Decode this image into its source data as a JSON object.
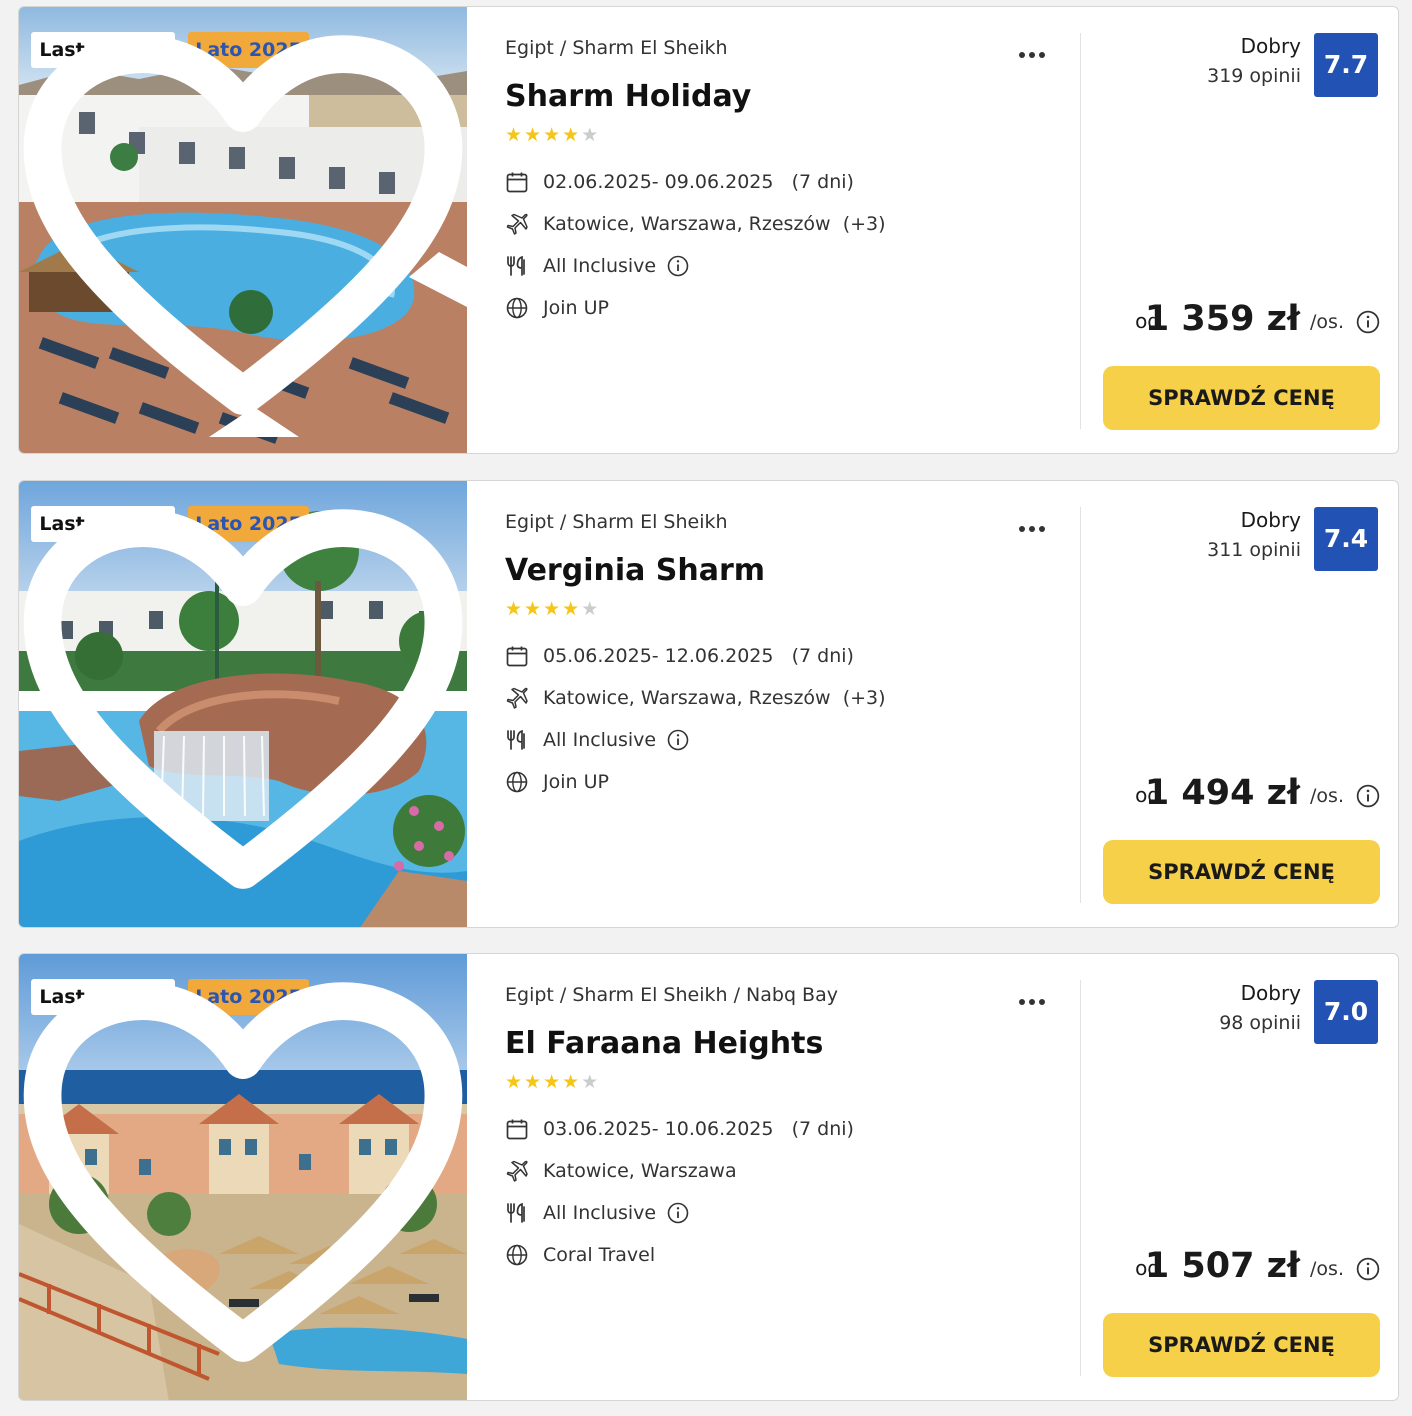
{
  "colors": {
    "badge_season_bg": "#f2a93b",
    "badge_season_text": "#2a55b3",
    "score_bg": "#2352b5",
    "cta_bg": "#f6d048",
    "star_filled": "#f5c518",
    "star_empty": "#cccccc"
  },
  "offers": [
    {
      "badge_last_minute": "Last minute",
      "badge_season": "Lato 2025",
      "location": "Egipt / Sharm El Sheikh",
      "name": "Sharm Holiday",
      "stars": 4,
      "max_stars": 5,
      "dates": "02.06.2025- 09.06.2025",
      "duration": "(7 dni)",
      "departures": "Katowice, Warszawa, Rzeszów",
      "departures_more": "(+3)",
      "board": "All Inclusive",
      "operator": "Join UP",
      "rating_label": "Dobry",
      "rating_count": "319 opinii",
      "score": "7.7",
      "price_from": "od",
      "price": "1 359 zł",
      "price_unit": "/os.",
      "cta": "SPRAWDŹ CENĘ"
    },
    {
      "badge_last_minute": "Last minute",
      "badge_season": "Lato 2025",
      "location": "Egipt / Sharm El Sheikh",
      "name": "Verginia Sharm",
      "stars": 4,
      "max_stars": 5,
      "dates": "05.06.2025- 12.06.2025",
      "duration": "(7 dni)",
      "departures": "Katowice, Warszawa, Rzeszów",
      "departures_more": "(+3)",
      "board": "All Inclusive",
      "operator": "Join UP",
      "rating_label": "Dobry",
      "rating_count": "311 opinii",
      "score": "7.4",
      "price_from": "od",
      "price": "1 494 zł",
      "price_unit": "/os.",
      "cta": "SPRAWDŹ CENĘ"
    },
    {
      "badge_last_minute": "Last minute",
      "badge_season": "Lato 2025",
      "location": "Egipt / Sharm El Sheikh / Nabq Bay",
      "name": "El Faraana Heights",
      "stars": 4,
      "max_stars": 5,
      "dates": "03.06.2025- 10.06.2025",
      "duration": "(7 dni)",
      "departures": "Katowice, Warszawa",
      "departures_more": "",
      "board": "All Inclusive",
      "operator": "Coral Travel",
      "rating_label": "Dobry",
      "rating_count": "98 opinii",
      "score": "7.0",
      "price_from": "od",
      "price": "1 507 zł",
      "price_unit": "/os.",
      "cta": "SPRAWDŹ CENĘ"
    }
  ],
  "icons": {
    "favorite": "heart-outline-icon",
    "more": "more-horizontal-icon",
    "dates": "calendar-icon",
    "departures": "airplane-icon",
    "board": "cutlery-icon",
    "board_info": "info-icon",
    "operator": "globe-icon",
    "price_info": "info-icon"
  }
}
